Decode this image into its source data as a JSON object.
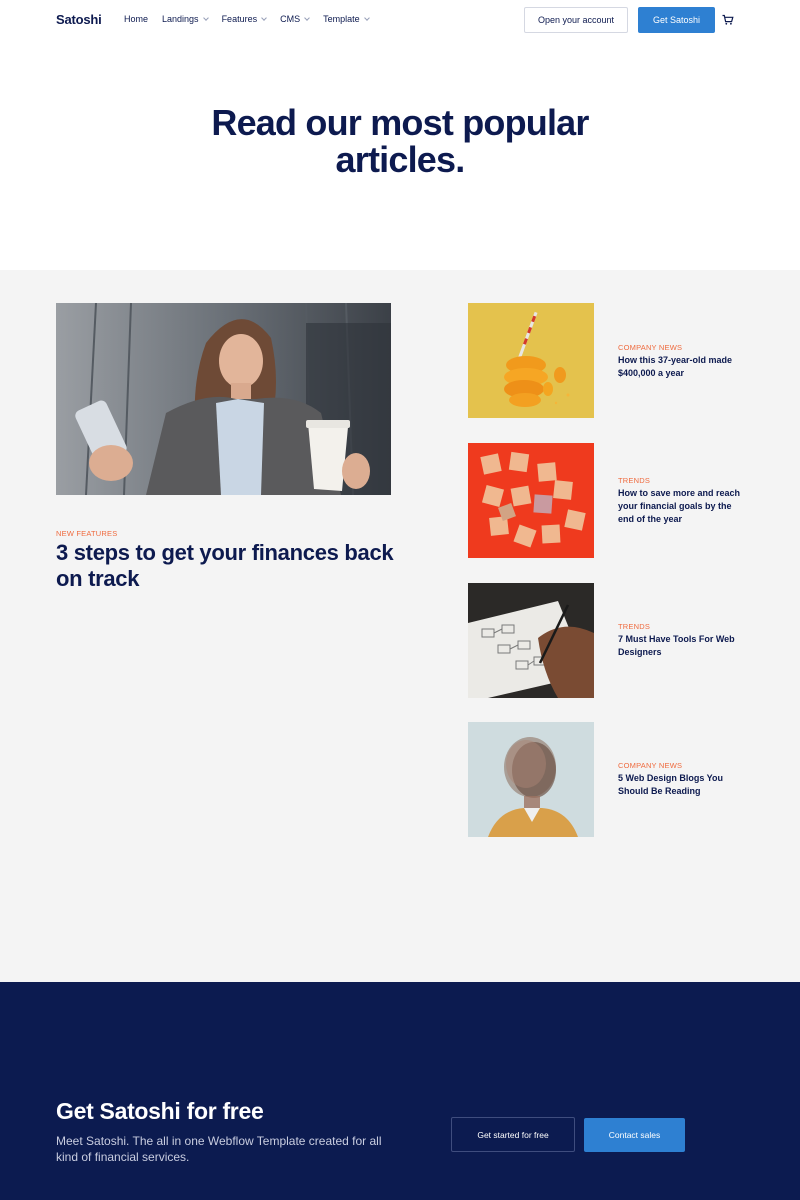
{
  "nav": {
    "logo": "Satoshi",
    "items": [
      {
        "label": "Home",
        "has_dropdown": false
      },
      {
        "label": "Landings",
        "has_dropdown": true
      },
      {
        "label": "Features",
        "has_dropdown": true
      },
      {
        "label": "CMS",
        "has_dropdown": true
      },
      {
        "label": "Template",
        "has_dropdown": true
      }
    ],
    "open_account_label": "Open your account",
    "get_label": "Get Satoshi",
    "cart_icon": "cart-icon"
  },
  "hero": {
    "title_line1": "Read our most popular",
    "title_line2": "articles."
  },
  "featured": {
    "category": "NEW FEATURES",
    "title": "3 steps to get your finances back on track",
    "image": "woman-with-phone-and-coffee"
  },
  "articles": [
    {
      "category": "COMPANY NEWS",
      "title": "How this 37-year-old made $400,000 a year",
      "image": "orange-slices-with-straw"
    },
    {
      "category": "TRENDS",
      "title": "How to save more and reach your financial goals by the end of the year",
      "image": "wooden-blocks-on-red"
    },
    {
      "category": "TRENDS",
      "title": "7 Must Have Tools For Web Designers",
      "image": "hand-drawing-wireframe"
    },
    {
      "category": "COMPANY NEWS",
      "title": "5 Web Design Blogs You Should Be Reading",
      "image": "blurred-man-portrait"
    }
  ],
  "cta": {
    "title": "Get Satoshi for free",
    "text": "Meet Satoshi. The all in one Webflow Template created for all kind of financial services.",
    "secondary_label": "Get started for free",
    "primary_label": "Contact sales"
  },
  "colors": {
    "navy": "#0d1a4f",
    "accent_blue": "#2e80d2",
    "category_orange": "#ef6b3f",
    "section_gray": "#f4f4f4",
    "cta_bg": "#0c1b50"
  }
}
